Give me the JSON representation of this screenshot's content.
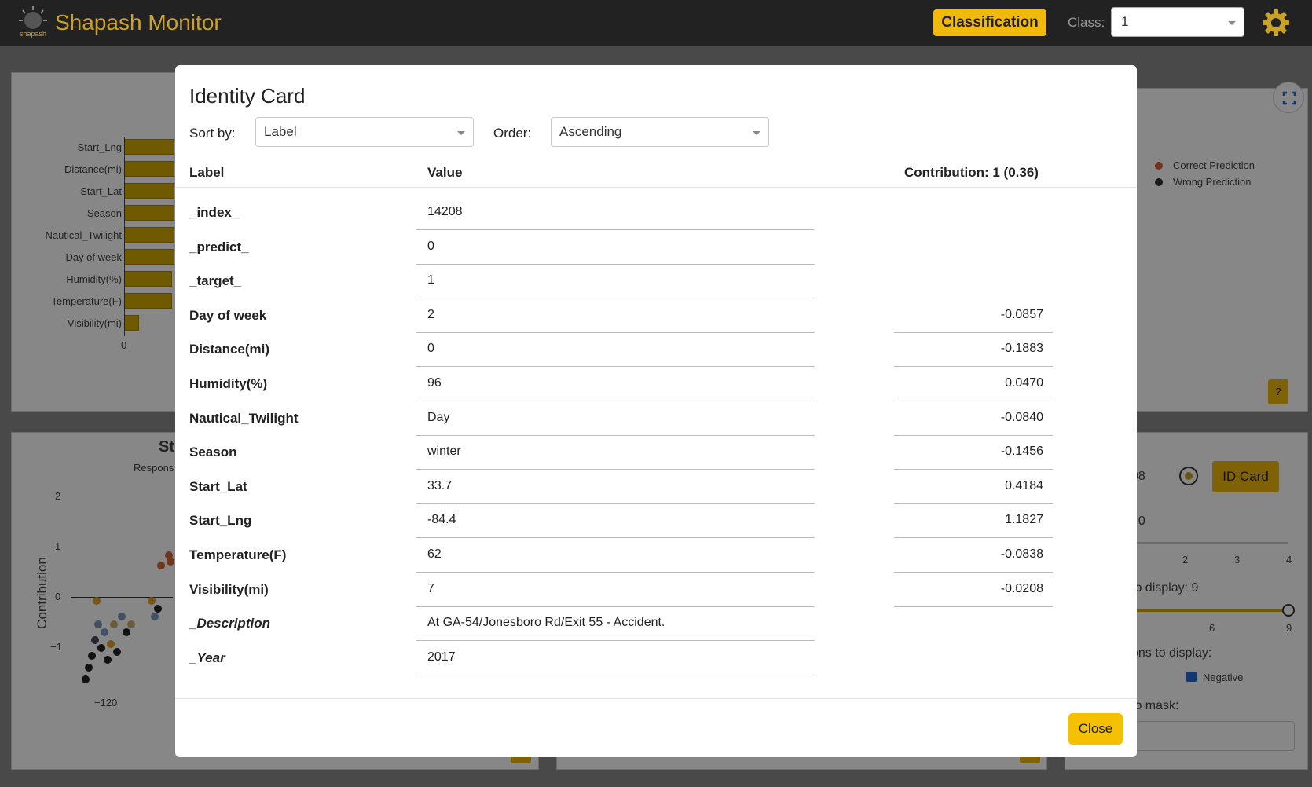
{
  "navbar": {
    "title": "Shapash Monitor",
    "logo_text": "shapash",
    "mode_button": "Classification",
    "class_label": "Class:",
    "class_value": "1"
  },
  "background": {
    "feature_labels": [
      "Start_Lng",
      "Distance(mi)",
      "Start_Lat",
      "Season",
      "Nautical_Twilight",
      "Day of week",
      "Humidity(%)",
      "Temperature(F)",
      "Visibility(mi)"
    ],
    "feature_bar_levels": [
      1.0,
      1.0,
      1.0,
      1.0,
      1.0,
      1.0,
      0.96,
      0.95,
      0.3
    ],
    "bar_axis_zero": "0",
    "legend": [
      "Correct Prediction",
      "Wrong Prediction"
    ],
    "legend_colors": [
      "#d9652c",
      "#333333"
    ],
    "help_button": "?",
    "scatter_title_fragment": "St",
    "scatter_subtitle_fragment": "Respons",
    "scatter_ylabel": "Contribution",
    "scatter_yticks": [
      "2",
      "1",
      "0",
      "−1"
    ],
    "scatter_xtick": "−120",
    "index_fragment": "08",
    "id_card_button": "ID Card",
    "threshold_fragment": ": 0",
    "slider1_ticks": [
      "2",
      "3",
      "4"
    ],
    "features_to_display_fragment": "to display: 9",
    "slider2_ticks": [
      "6",
      "9"
    ],
    "contributions_fragment": "ons to display:",
    "negative_label": "Negative",
    "mask_fragment": "to mask:"
  },
  "modal": {
    "title": "Identity Card",
    "sort_label": "Sort by:",
    "sort_value": "Label",
    "order_label": "Order:",
    "order_value": "Ascending",
    "columns": {
      "label": "Label",
      "value": "Value",
      "contribution": "Contribution: 1 (0.36)"
    },
    "rows": [
      {
        "label": "_index_",
        "value": "14208",
        "contribution": ""
      },
      {
        "label": "_predict_",
        "value": "0",
        "contribution": ""
      },
      {
        "label": "_target_",
        "value": "1",
        "contribution": ""
      },
      {
        "label": "Day of week",
        "value": "2",
        "contribution": "-0.0857"
      },
      {
        "label": "Distance(mi)",
        "value": "0",
        "contribution": "-0.1883"
      },
      {
        "label": "Humidity(%)",
        "value": "96",
        "contribution": "0.0470"
      },
      {
        "label": "Nautical_Twilight",
        "value": "Day",
        "contribution": "-0.0840"
      },
      {
        "label": "Season",
        "value": "winter",
        "contribution": "-0.1456"
      },
      {
        "label": "Start_Lat",
        "value": "33.7",
        "contribution": "0.4184"
      },
      {
        "label": "Start_Lng",
        "value": "-84.4",
        "contribution": "1.1827"
      },
      {
        "label": "Temperature(F)",
        "value": "62",
        "contribution": "-0.0838"
      },
      {
        "label": "Visibility(mi)",
        "value": "7",
        "contribution": "-0.0208"
      },
      {
        "label": "_Description",
        "value": "At GA-54/Jonesboro Rd/Exit 55 - Accident.",
        "contribution": ""
      },
      {
        "label": "_Year",
        "value": "2017",
        "contribution": ""
      }
    ],
    "close_button": "Close"
  }
}
